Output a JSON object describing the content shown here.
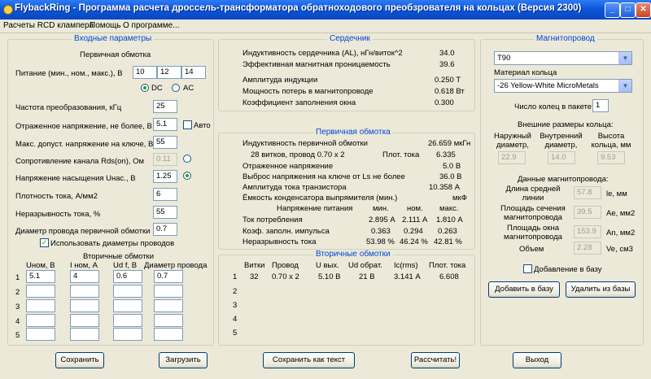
{
  "window": {
    "title": "FlybackRing - Программа расчета дроссель-трансформатора обратноходового преобзрователя на кольцах (Версия 2300)",
    "min": "_",
    "max": "□",
    "close": "✕"
  },
  "menu": [
    "Расчеты RCD клампера",
    "Помощь",
    "О программе..."
  ],
  "inputs": {
    "title": "Входные параметры",
    "primary_title": "Первичная обмотка",
    "supply_label": "Питание (мин., ном., макс.), В",
    "supply": [
      "10",
      "12",
      "14"
    ],
    "dc_label": "DC",
    "ac_label": "AC",
    "fields": [
      {
        "label": "Частота преобразования, кГц",
        "value": "25"
      },
      {
        "label": "Отраженное напряжение, не более, В",
        "value": "5.1"
      },
      {
        "label": "Макс. допуст. напряжение на ключе, В",
        "value": "55"
      },
      {
        "label": "Сопротивление канала Rds(on), Ом",
        "value": "0.11"
      },
      {
        "label": "Напряжение насыщения Uнас., В",
        "value": "1.25"
      },
      {
        "label": "Плотность тока, А/мм2",
        "value": "6"
      },
      {
        "label": "Неразрывность тока, %",
        "value": "55"
      },
      {
        "label": "Диаметр провода первичной обмотки",
        "value": "0.7"
      }
    ],
    "auto_label": "Авто",
    "use_diam_label": "Использовать диаметры проводов",
    "secondary_title": "Вторичные обмотки",
    "sec_headers": [
      "Uном, В",
      "I ном, А",
      "Ud f, В",
      "Диаметр провода"
    ],
    "sec_rows": [
      {
        "n": "1",
        "vals": [
          "5.1",
          "4",
          "0.6",
          "0.7"
        ]
      },
      {
        "n": "2",
        "vals": [
          "",
          "",
          "",
          ""
        ]
      },
      {
        "n": "3",
        "vals": [
          "",
          "",
          "",
          ""
        ]
      },
      {
        "n": "4",
        "vals": [
          "",
          "",
          "",
          ""
        ]
      },
      {
        "n": "5",
        "vals": [
          "",
          "",
          "",
          ""
        ]
      }
    ]
  },
  "core": {
    "title": "Сердечник",
    "rows": [
      {
        "label": "Индуктивность сердечника (AL), нГн/виток^2",
        "value": "34.0"
      },
      {
        "label": "Эффективная магнитная проницаемость",
        "value": "39.6"
      },
      {
        "label": "Амплитуда индукции",
        "value": "0.250 Т"
      },
      {
        "label": "Мощность потерь в магнитопроводе",
        "value": "0.618 Вт"
      },
      {
        "label": "Коэффициент заполнения окна",
        "value": "0.300"
      }
    ]
  },
  "primary": {
    "title": "Первичная обмотка",
    "inductance_label": "Индуктивность первичной обмотки",
    "inductance_value": "26.659 мкГн",
    "turns_label": "28 витков, провод 0.70 x 2",
    "plot_label": "Плот. тока",
    "plot_value": "6.335",
    "rows": [
      {
        "label": "Отраженное напряжение",
        "value": "5.0 В"
      },
      {
        "label": "Выброс напряжения на ключе от Ls не более",
        "value": "36.0 В"
      },
      {
        "label": "Амплитуда тока транзистора",
        "value": "10.358 А"
      },
      {
        "label": "Ёмкость конденсатора выпрямителя (мин.)",
        "value": "мкФ"
      }
    ],
    "table_headers": [
      "Напряжение питания",
      "мин.",
      "ном.",
      "макс."
    ],
    "table_rows": [
      {
        "label": "Ток потребления",
        "vals": [
          "2.895 А",
          "2.111 А",
          "1.810 А"
        ]
      },
      {
        "label": "Коэф. заполн. импульса",
        "vals": [
          "0.363",
          "0.294",
          "0.263"
        ]
      },
      {
        "label": "Неразрывность тока",
        "vals": [
          "53.98 %",
          "46.24 %",
          "42.81 %"
        ]
      }
    ]
  },
  "secondary": {
    "title": "Вторичные обмотки",
    "headers": [
      "Витки",
      "Провод",
      "U вых.",
      "Ud обрат.",
      "Ic(rms)",
      "Плот. тока"
    ],
    "rows": [
      {
        "n": "1",
        "vals": [
          "32",
          "0.70 x 2",
          "5.10 В",
          "21 В",
          "3.141 А",
          "6.608"
        ]
      },
      {
        "n": "2",
        "vals": []
      },
      {
        "n": "3",
        "vals": []
      },
      {
        "n": "4",
        "vals": []
      },
      {
        "n": "5",
        "vals": []
      }
    ]
  },
  "magnetic": {
    "title": "Магнитопровод",
    "core_select": "T90",
    "material_label": "Материал кольца",
    "material_select": "-26 Yellow-White MicroMetals",
    "rings_label": "Число колец в пакете",
    "rings_value": "1",
    "dims_title": "Внешние размеры кольца:",
    "dim_labels": [
      "Наружный диаметр, мм",
      "Внутренний диаметр, мм",
      "Высота кольца, мм"
    ],
    "dim_values": [
      "22.9",
      "14.0",
      "9.53"
    ],
    "data_title": "Данные магнитопровода:",
    "data_rows": [
      {
        "label": "Длина средней линии",
        "value": "57.8",
        "unit": "le, мм"
      },
      {
        "label": "Площадь сечения магнитопровода",
        "value": "39.5",
        "unit": "Ae, мм2"
      },
      {
        "label": "Площадь окна магнитопровода",
        "value": "153.9",
        "unit": "An, мм2"
      },
      {
        "label": "Объем",
        "value": "2.28",
        "unit": "Ve, см3"
      }
    ],
    "add_check_label": "Добавление в базу",
    "add_button": "Добавить в базу",
    "del_button": "Удалить из базы"
  },
  "buttons": {
    "save": "Сохранить",
    "load": "Загрузить",
    "save_text": "Сохранить как текст",
    "calc": "Рассчитать!",
    "exit": "Выход"
  }
}
